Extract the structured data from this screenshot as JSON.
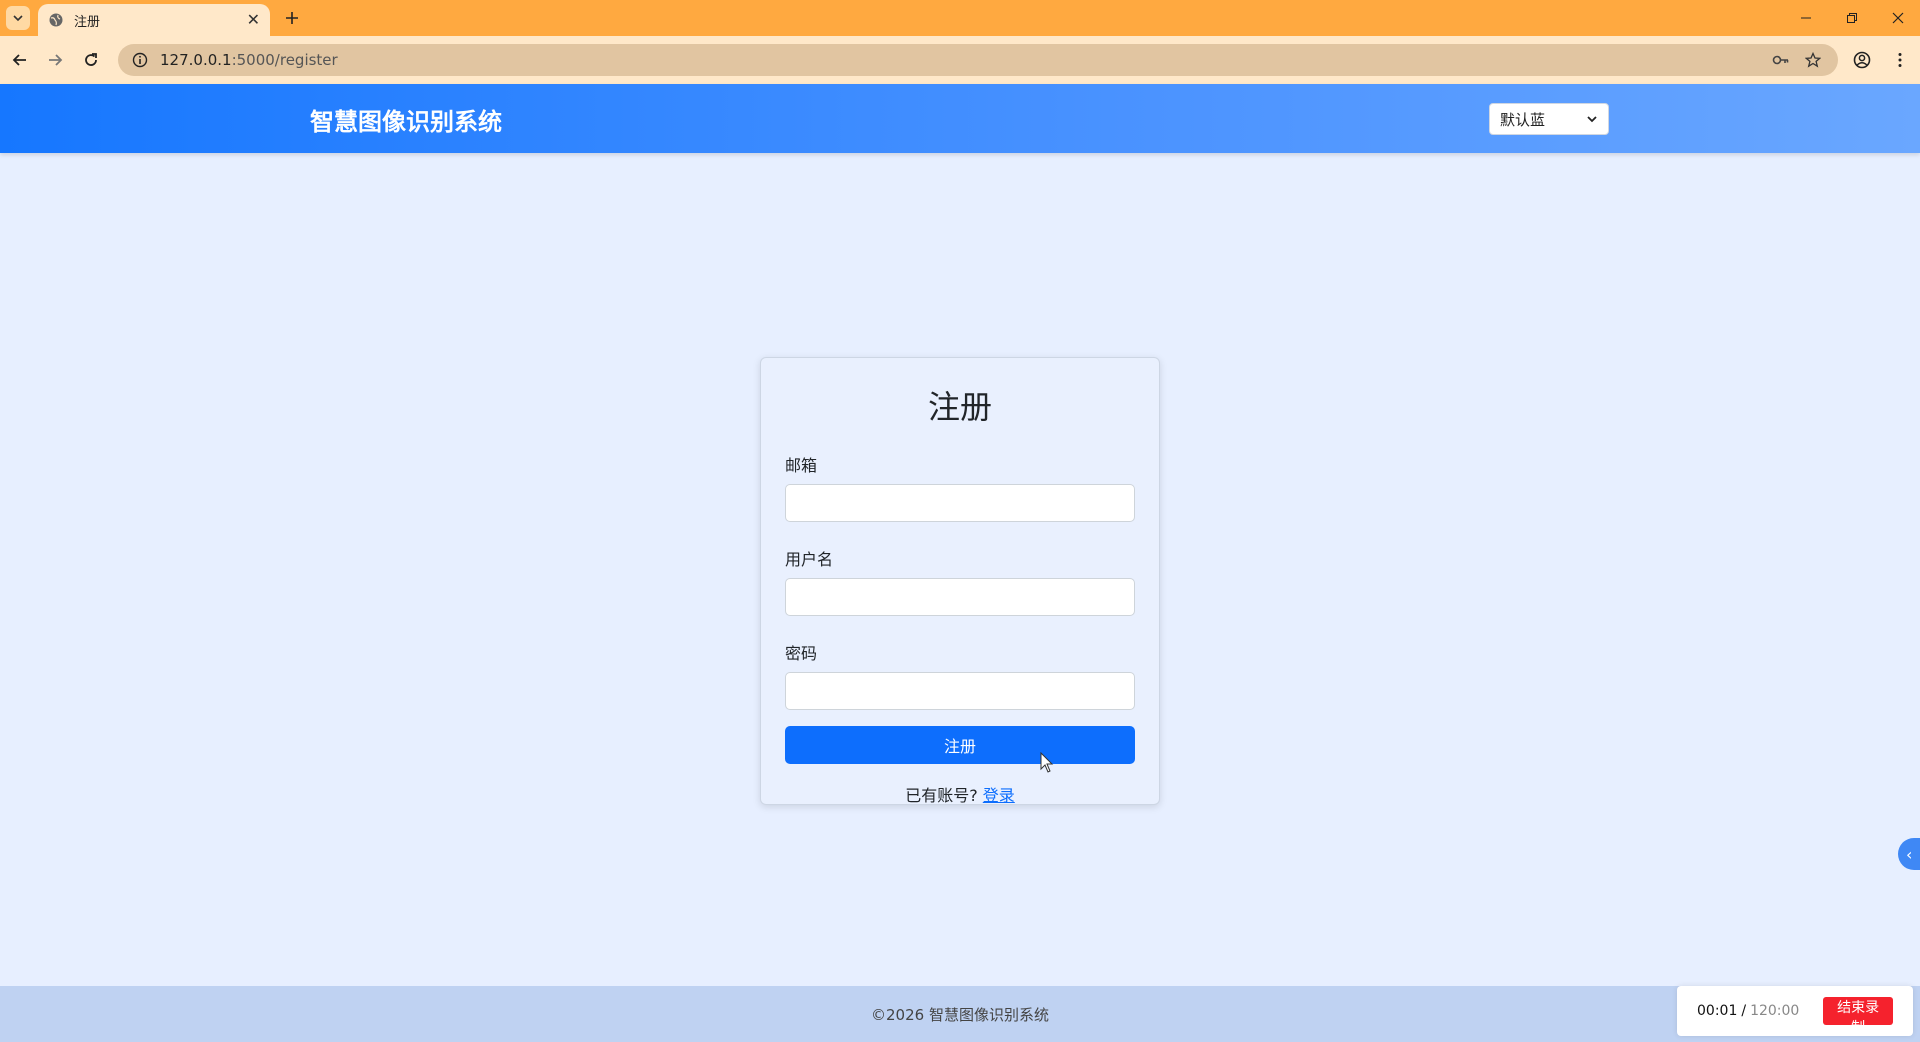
{
  "browser": {
    "tab_title": "注册",
    "url_host": "127.0.0.1",
    "url_rest": ":5000/register"
  },
  "app": {
    "brand": "智慧图像识别系统",
    "theme_select_value": "默认蓝"
  },
  "register": {
    "title": "注册",
    "email_label": "邮箱",
    "username_label": "用户名",
    "password_label": "密码",
    "email_value": "",
    "username_value": "",
    "password_value": "",
    "submit_label": "注册",
    "have_account_text": "已有账号?",
    "login_link": "登录"
  },
  "footer": {
    "copyright": "©2026 智慧图像识别系统"
  },
  "recorder": {
    "elapsed": "00:01",
    "separator": "/",
    "total": "120:00",
    "stop_label": "结束录制"
  },
  "side_handle": {
    "glyph": "‹"
  },
  "icons": {
    "tab_search": "chevron-down-icon",
    "tab_favicon": "globe-icon",
    "tab_close": "close-icon",
    "new_tab": "plus-icon",
    "minimize": "minimize-icon",
    "restore": "restore-icon",
    "window_close": "close-icon",
    "back": "arrow-left-icon",
    "forward": "arrow-right-icon",
    "reload": "reload-icon",
    "site_info": "info-icon",
    "password_key": "key-icon",
    "bookmark": "star-icon",
    "profile": "profile-icon",
    "menu": "kebab-menu-icon",
    "select_arrow": "chevron-down-icon"
  },
  "colors": {
    "tabstrip": "#ffa940",
    "header_start": "#1677ff",
    "primary_button": "#0d6efd",
    "stop_button": "#f5222d"
  }
}
